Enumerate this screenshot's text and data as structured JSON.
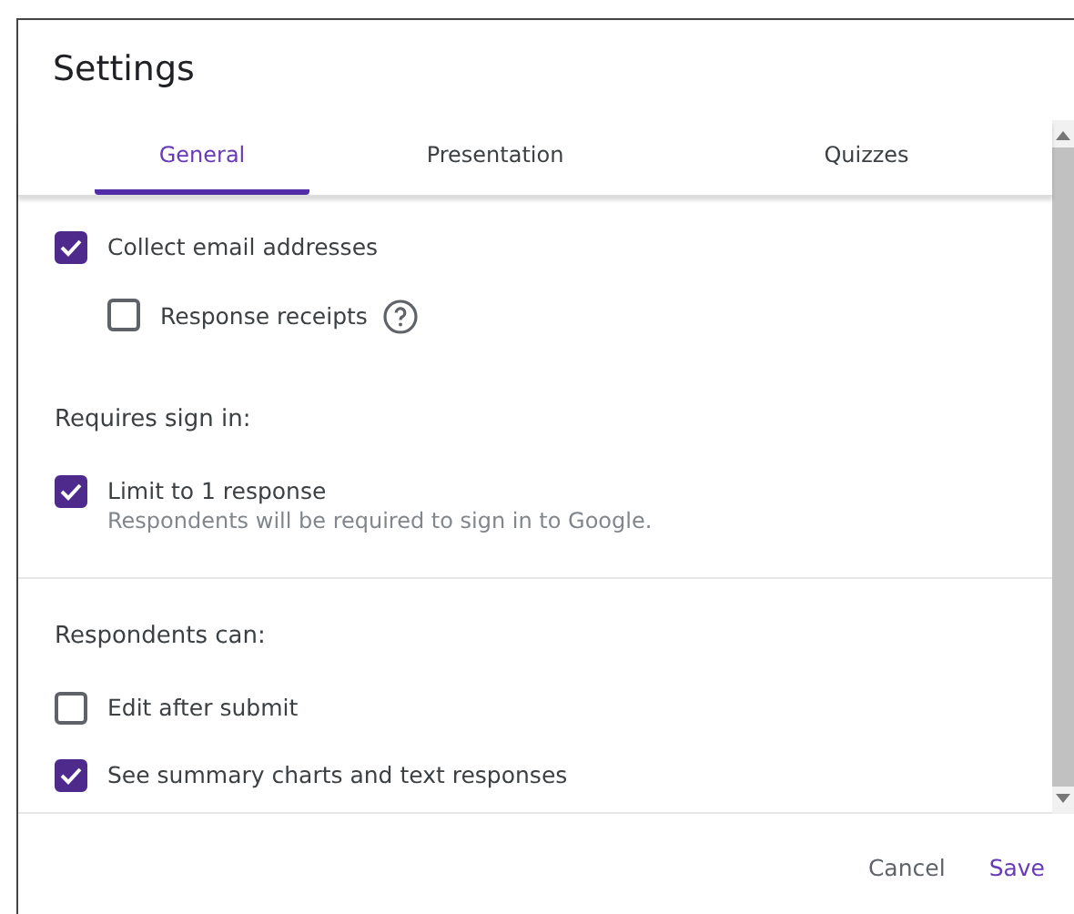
{
  "dialog": {
    "title": "Settings"
  },
  "tabs": [
    {
      "label": "General",
      "selected": true
    },
    {
      "label": "Presentation",
      "selected": false
    },
    {
      "label": "Quizzes",
      "selected": false
    }
  ],
  "sections": [
    {
      "options": [
        {
          "label": "Collect email addresses",
          "checked": true,
          "children": [
            {
              "label": "Response receipts",
              "checked": false,
              "help": true
            }
          ]
        }
      ]
    },
    {
      "heading": "Requires sign in:",
      "options": [
        {
          "label": "Limit to 1 response",
          "checked": true,
          "description": "Respondents will be required to sign in to Google."
        }
      ]
    },
    {
      "heading": "Respondents can:",
      "divider": true,
      "options": [
        {
          "label": "Edit after submit",
          "checked": false
        },
        {
          "label": "See summary charts and text responses",
          "checked": true
        }
      ]
    }
  ],
  "buttons": [
    {
      "label": "Cancel",
      "kind": "secondary"
    },
    {
      "label": "Save",
      "kind": "primary"
    }
  ]
}
